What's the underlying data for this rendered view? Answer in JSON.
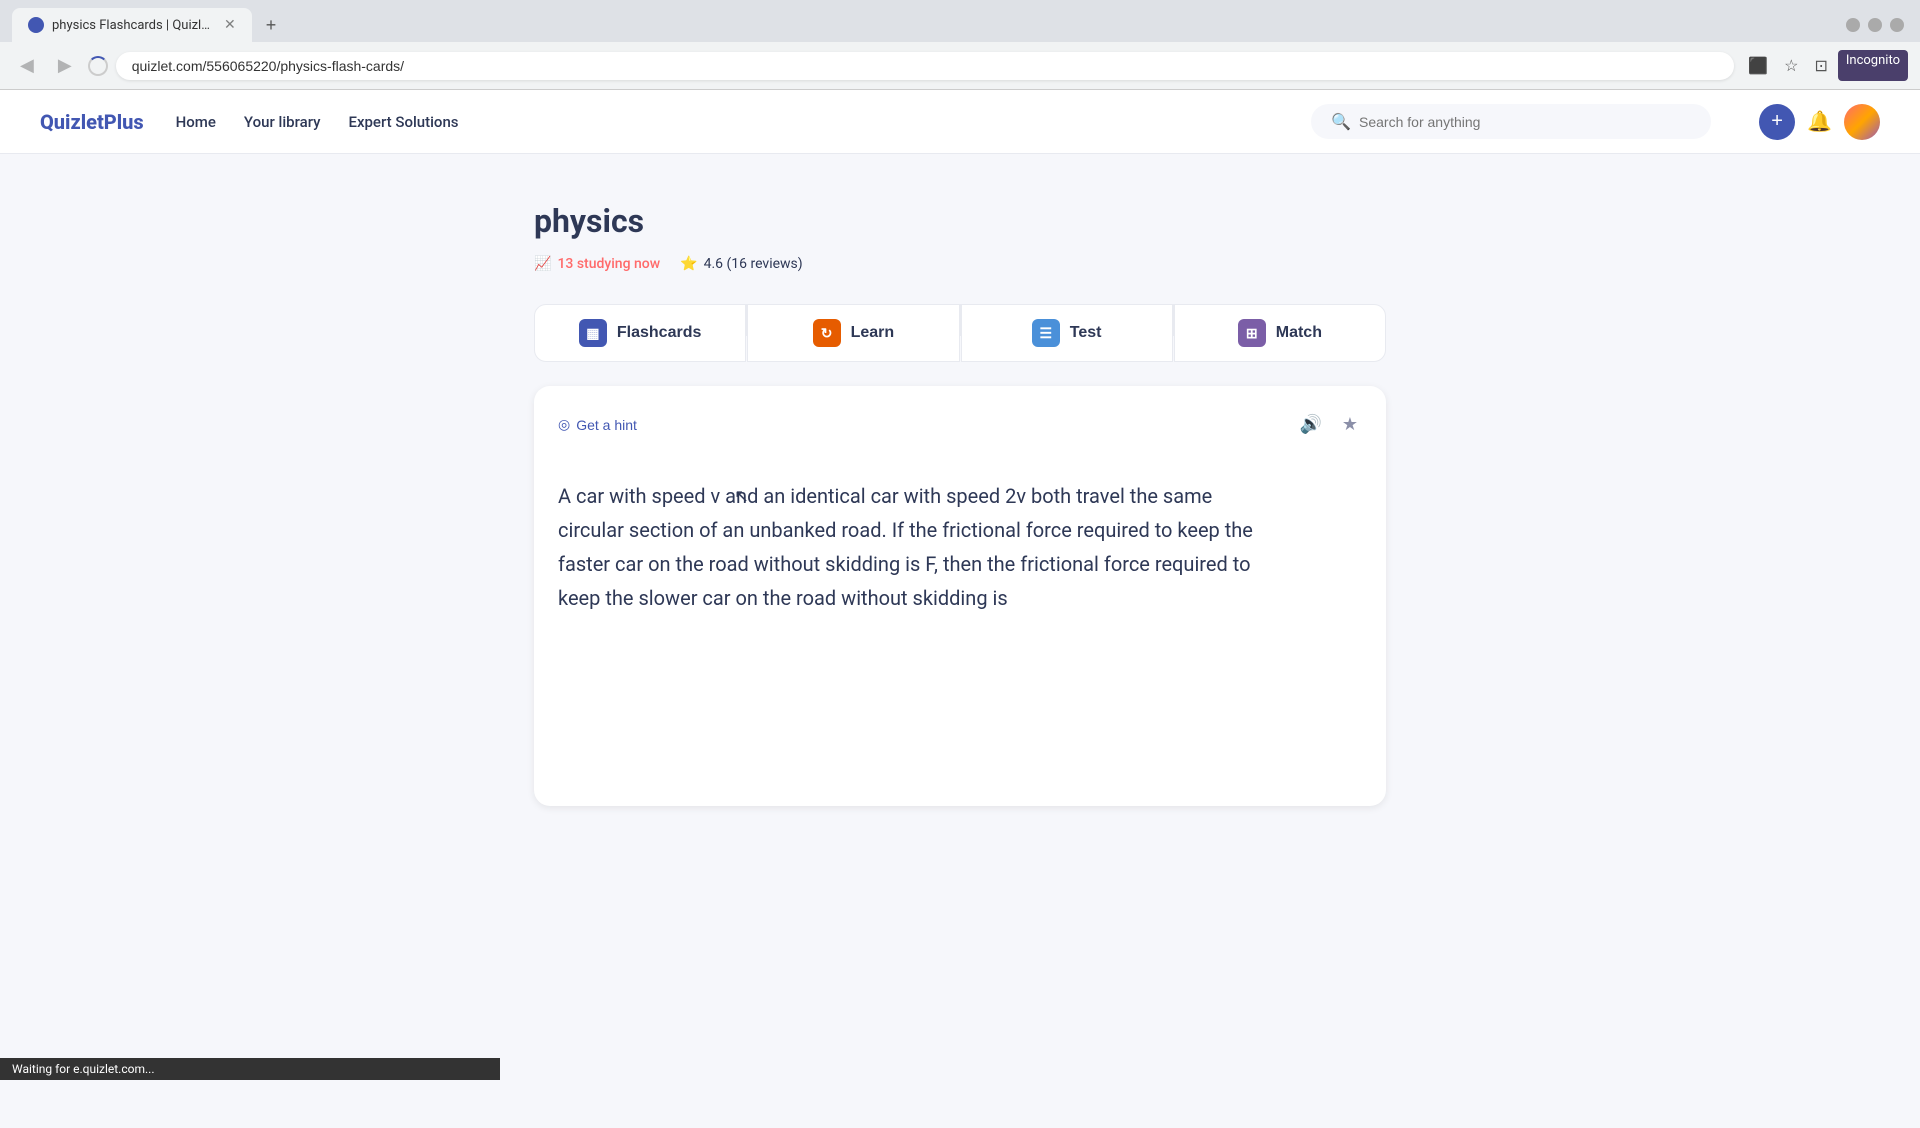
{
  "browser": {
    "tab_title": "physics Flashcards | Quizlet",
    "url": "quizlet.com/556065220/physics-flash-cards/",
    "new_tab_label": "+",
    "back_icon": "◀",
    "forward_icon": "▶",
    "reload_icon": "✕",
    "home_icon": "⌂"
  },
  "nav": {
    "logo": "QuizletPlus",
    "links": [
      {
        "label": "Home",
        "key": "home"
      },
      {
        "label": "Your library",
        "key": "library"
      },
      {
        "label": "Expert Solutions",
        "key": "expert"
      }
    ],
    "search_placeholder": "Search for anything",
    "plus_label": "+",
    "incognito_label": "Incognito"
  },
  "set": {
    "title": "physics",
    "studying_now": "13 studying now",
    "rating": "4.6 (16 reviews)"
  },
  "modes": [
    {
      "key": "flashcards",
      "label": "Flashcards",
      "icon": "▦"
    },
    {
      "key": "learn",
      "label": "Learn",
      "icon": "↻"
    },
    {
      "key": "test",
      "label": "Test",
      "icon": "☰"
    },
    {
      "key": "match",
      "label": "Match",
      "icon": "⊞"
    }
  ],
  "flashcard": {
    "hint_label": "Get a hint",
    "hint_icon": "◎",
    "audio_icon": "🔊",
    "star_icon": "★",
    "content": "A car with speed v and an identical car with speed 2v both travel the same circular section of an unbanked road. If the frictional force required to keep the faster car on the road without skidding is F, then the frictional force required to keep the slower car on the road without skidding is"
  },
  "status_bar": {
    "text": "Waiting for e.quizlet.com..."
  }
}
